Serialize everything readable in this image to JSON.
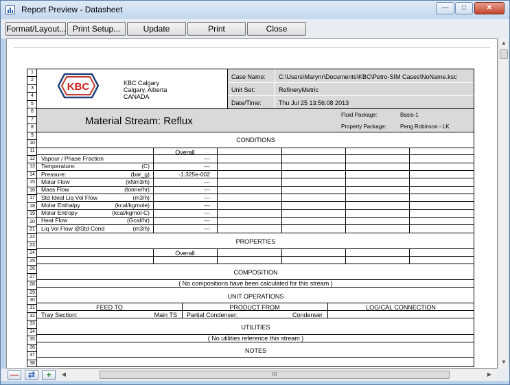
{
  "window": {
    "title": "Report Preview - Datasheet",
    "minimize_icon": "minimize-icon",
    "maximize_icon": "maximize-icon",
    "close_icon": "close-icon"
  },
  "toolbar": {
    "format_layout": "Format/Layout...",
    "print_setup": "Print Setup...",
    "update": "Update",
    "print": "Print",
    "close": "Close"
  },
  "header": {
    "company_logo_text": "KBC",
    "company_line1": "KBC Calgary",
    "company_line2": "Calgary, Alberta",
    "company_line3": "CANADA",
    "case_name_label": "Case Name:",
    "case_name_value": "C:\\Users\\Marynr\\Documents\\KBC\\Petro-SIM Cases\\NoName.ksc",
    "unit_set_label": "Unit Set:",
    "unit_set_value": "RefineryMetric",
    "datetime_label": "Date/Time:",
    "datetime_value": "Thu Jul 25 13:56:08 2013",
    "stream_title": "Material Stream:  Reflux",
    "fluid_package_label": "Fluid Package:",
    "fluid_package_value": "Basis-1",
    "property_package_label": "Property Package:",
    "property_package_value": "Peng Robinson - LK"
  },
  "row_numbers": [
    "1",
    "2",
    "3",
    "4",
    "5",
    "6",
    "7",
    "8",
    "9",
    "10",
    "11",
    "12",
    "13",
    "14",
    "15",
    "16",
    "17",
    "18",
    "19",
    "20",
    "21",
    "22",
    "23",
    "24",
    "25",
    "26",
    "27",
    "28",
    "29",
    "30",
    "31",
    "32",
    "33",
    "34",
    "35",
    "36",
    "37",
    "38"
  ],
  "conditions": {
    "section_title": "CONDITIONS",
    "overall_header": "Overall",
    "rows": [
      {
        "name": "Vapour / Phase Fraction",
        "unit": "",
        "value": "---"
      },
      {
        "name": "Temperature:",
        "unit": "(C)",
        "value": "---"
      },
      {
        "name": "Pressure:",
        "unit": "(bar_g)",
        "value": "-1.325e-002"
      },
      {
        "name": "Molar Flow",
        "unit": "(kNm3/h)",
        "value": "---"
      },
      {
        "name": "Mass Flow",
        "unit": "(tonne/hr)",
        "value": "---"
      },
      {
        "name": "Std Ideal Liq Vol Flow",
        "unit": "(m3/h)",
        "value": "---"
      },
      {
        "name": "Molar Enthalpy",
        "unit": "(kcal/kgmole)",
        "value": "---"
      },
      {
        "name": "Molar Entropy",
        "unit": "(kcal/kgmol-C)",
        "value": "---"
      },
      {
        "name": "Heat Flow",
        "unit": "(Gcal/hr)",
        "value": "---"
      },
      {
        "name": "Liq Vol Flow @Std Cond",
        "unit": "(m3/h)",
        "value": "---"
      }
    ]
  },
  "properties": {
    "section_title": "PROPERTIES",
    "overall_header": "Overall"
  },
  "composition": {
    "section_title": "COMPOSITION",
    "note": "( No compositions have been calculated for this stream )"
  },
  "unit_operations": {
    "section_title": "UNIT OPERATIONS",
    "feed_to_header": "FEED TO",
    "product_from_header": "PRODUCT FROM",
    "logical_connection_header": "LOGICAL CONNECTION",
    "feed_to_label": "Tray Section:",
    "feed_to_value": "Main TS",
    "product_from_label": "Partial Condenser:",
    "product_from_value": "Condenser"
  },
  "utilities": {
    "section_title": "UTILITIES",
    "note": "( No utilities reference this stream )"
  },
  "notes": {
    "section_title": "NOTES"
  },
  "scrollbar": {
    "hthumb_grip": "III"
  }
}
